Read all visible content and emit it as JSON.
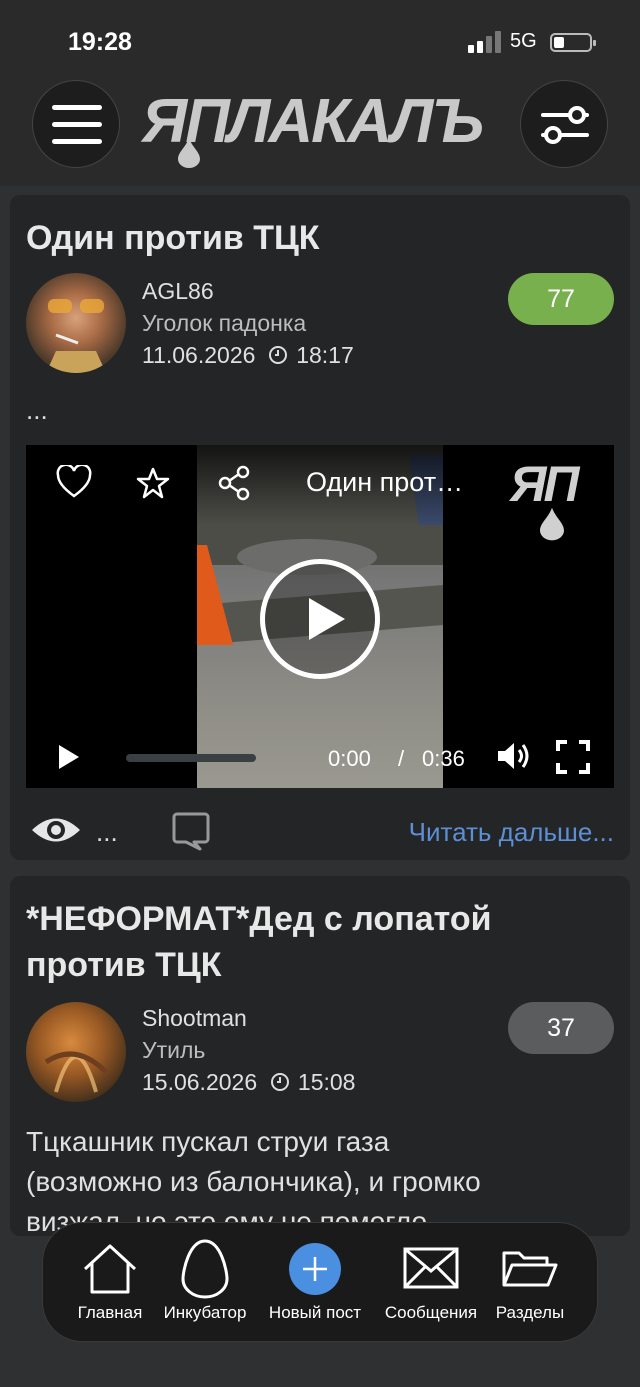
{
  "status_bar": {
    "time": "19:28",
    "network": "5G"
  },
  "header": {
    "logo_text": "ЯПЛАКАЛЪ"
  },
  "posts": [
    {
      "title": "Один против ТЦК",
      "author": "AGL86",
      "section": "Уголок падонка",
      "date": "11.06.2026",
      "time": "18:17",
      "score": "77",
      "body_preview": "...",
      "video": {
        "title": "Один прот…",
        "watermark": "ЯП",
        "current_time": "0:00",
        "separator": "/",
        "duration": "0:36"
      },
      "views": "...",
      "read_more": "Читать дальше..."
    },
    {
      "title_line1": "*НЕФОРМАТ*Дед с лопатой",
      "title_line2": "против ТЦК",
      "author": "Shootman",
      "section": "Утиль",
      "date": "15.06.2026",
      "time": "15:08",
      "score": "37",
      "excerpt_line1": "Тцкашник пускал струи газа",
      "excerpt_line2": "(возможно из балончика), и громко",
      "excerpt_line3": "визжал, но это ему не помогло"
    }
  ],
  "tabbar": [
    {
      "label": "Главная"
    },
    {
      "label": "Инкубатор"
    },
    {
      "label": "Новый пост"
    },
    {
      "label": "Сообщения"
    },
    {
      "label": "Разделы"
    }
  ],
  "colors": {
    "score_green": "#77b04c",
    "link_blue": "#5c8fd6",
    "new_post_blue": "#4a8fe0"
  }
}
